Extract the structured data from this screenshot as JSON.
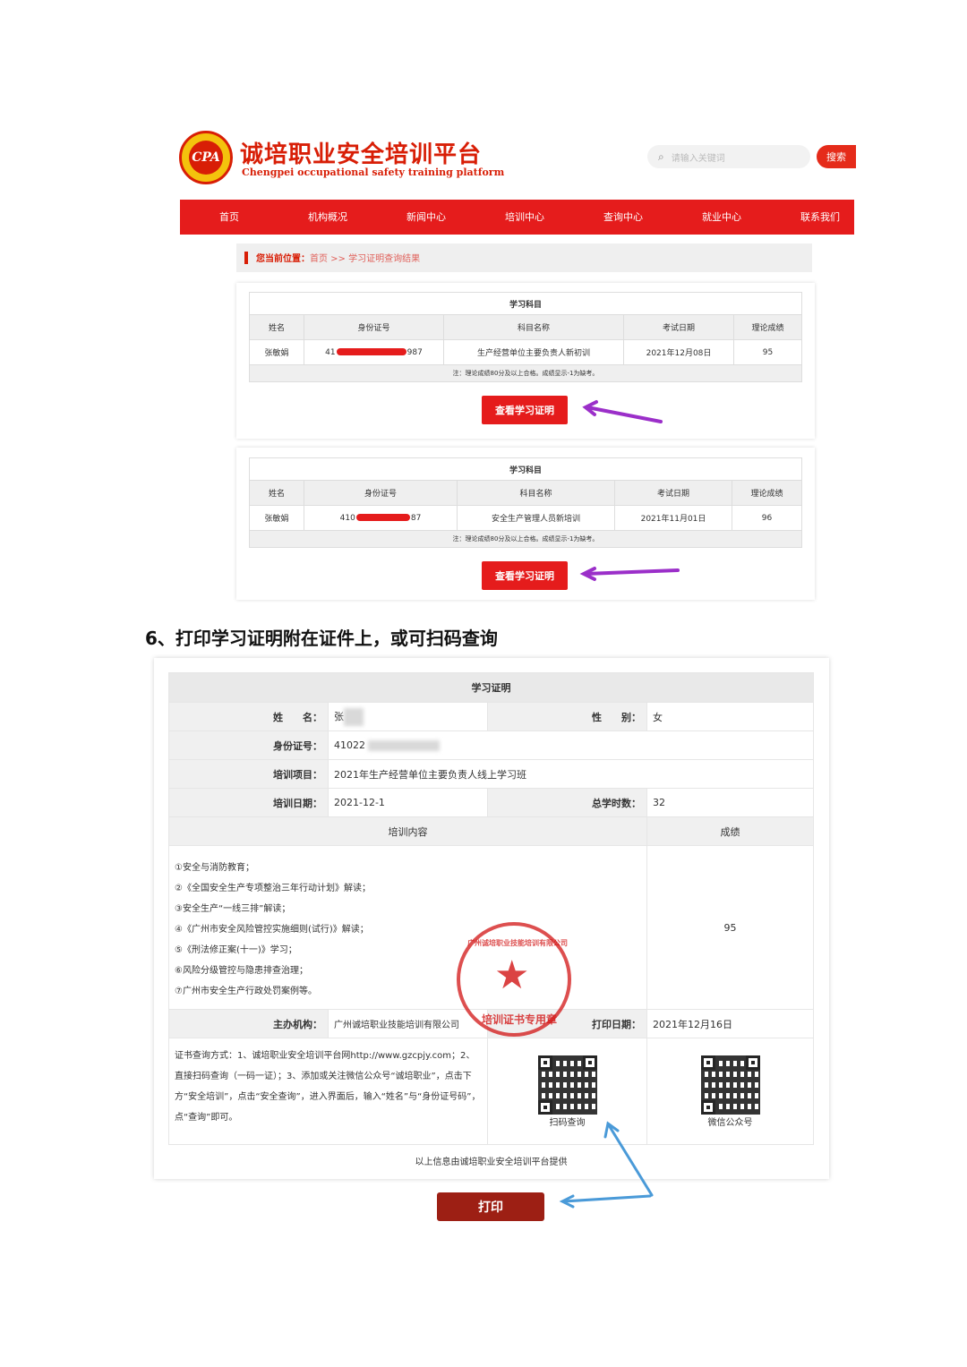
{
  "header": {
    "logo_mark": "CPA",
    "brand_cn": "诚培职业安全培训平台",
    "brand_en": "Chengpei occupational safety training platform",
    "search_placeholder": "请输入关键词",
    "search_button": "搜索"
  },
  "nav": [
    "首页",
    "机构概况",
    "新闻中心",
    "培训中心",
    "查询中心",
    "就业中心",
    "联系我们"
  ],
  "breadcrumb": {
    "prefix": "您当前位置：",
    "home": "首页",
    "sep": " >> ",
    "current": "学习证明查询结果"
  },
  "results": [
    {
      "title": "学习科目",
      "columns": [
        "姓名",
        "身份证号",
        "科目名称",
        "考试日期",
        "理论成绩"
      ],
      "row": {
        "name": "张敏娟",
        "id_prefix": "41",
        "id_suffix": "987",
        "subject": "生产经营单位主要负责人新初训",
        "date": "2021年12月08日",
        "score": "95"
      },
      "note": "注：理论成绩80分及以上合格。成绩显示-1为缺考。",
      "button": "查看学习证明"
    },
    {
      "title": "学习科目",
      "columns": [
        "姓名",
        "身份证号",
        "科目名称",
        "考试日期",
        "理论成绩"
      ],
      "row": {
        "name": "张敏娟",
        "id_prefix": "410",
        "id_suffix": "87",
        "subject": "安全生产管理人员新培训",
        "date": "2021年11月01日",
        "score": "96"
      },
      "note": "注：理论成绩80分及以上合格。成绩显示-1为缺考。",
      "button": "查看学习证明"
    }
  ],
  "section_heading": "6、打印学习证明附在证件上，或可扫码查询",
  "certificate": {
    "title": "学习证明",
    "name_label": "姓　　名：",
    "name_value": "张",
    "gender_label": "性　　别：",
    "gender_value": "女",
    "id_label": "身份证号：",
    "id_value": "41022",
    "project_label": "培训项目：",
    "project_value": "2021年生产经营单位主要负责人线上学习班",
    "date_label": "培训日期：",
    "date_value": "2021-12-1",
    "hours_label": "总学时数：",
    "hours_value": "32",
    "content_header": "培训内容",
    "score_header": "成绩",
    "contents": [
      "①安全与消防教育；",
      "②《全国安全生产专项整治三年行动计划》解读；",
      "③安全生产“一线三排”解读；",
      "④《广州市安全风险管控实施细则(试行)》解读；",
      "⑤《刑法修正案(十一)》学习；",
      "⑥风险分级管控与隐患排查治理；",
      "⑦广州市安全生产行政处罚案例等。"
    ],
    "score_value": "95",
    "org_label": "主办机构：",
    "org_value": "广州诚培职业技能培训有限公司",
    "print_date_label": "打印日期：",
    "print_date_value": "2021年12月16日",
    "query_text": "证书查询方式：1、诚培职业安全培训平台网http://www.gzcpjy.com；2、直接扫码查询（一码一证）；3、添加或关注微信公众号“诚培职业”，点击下方“安全培训”，点击“安全查询”，进入界面后，输入“姓名”与“身份证号码”，点“查询”即可。",
    "qr1_caption": "扫码查询",
    "qr2_caption": "微信公众号",
    "footer": "以上信息由诚培职业安全培训平台提供",
    "stamp_ring": "广州诚培职业技能培训有限公司",
    "stamp_bottom": "培训证书专用章"
  },
  "print_button": "打印",
  "colors": {
    "brand_red": "#e51c1c",
    "print_button": "#9d1f14",
    "purple_arrow": "#9b2fc9",
    "blue_arrow": "#4a9ad8"
  }
}
